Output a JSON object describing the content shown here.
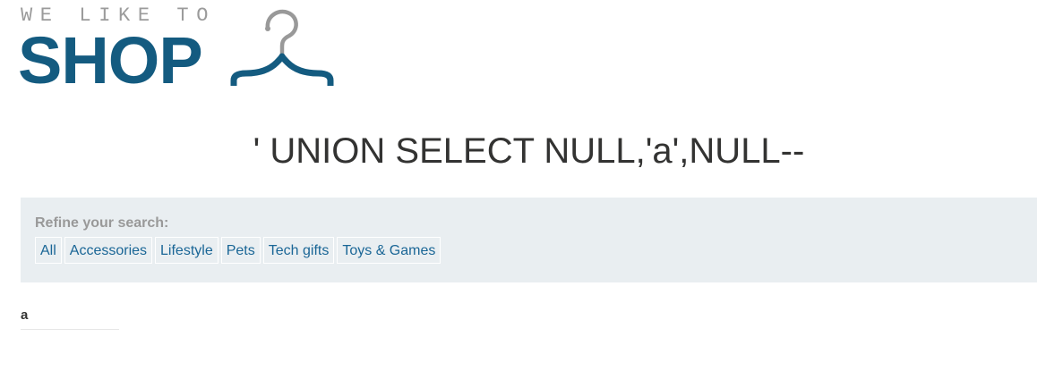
{
  "logo": {
    "tagline": "WE LIKE TO",
    "word": "SHOP",
    "icon": "hanger-icon",
    "colors": {
      "word": "#145b80",
      "tagline": "#9b9b9b",
      "hanger_hook": "#999999",
      "hanger_bar": "#145b80"
    }
  },
  "search": {
    "heading": "' UNION SELECT NULL,'a',NULL--"
  },
  "filters": {
    "label": "Refine your search:",
    "items": [
      {
        "label": "All"
      },
      {
        "label": "Accessories"
      },
      {
        "label": "Lifestyle"
      },
      {
        "label": "Pets"
      },
      {
        "label": "Tech gifts"
      },
      {
        "label": "Toys & Games"
      }
    ],
    "colors": {
      "panel_bg": "#e9eef1",
      "link": "#1a6696",
      "label": "#999999"
    }
  },
  "results": [
    {
      "text": "a"
    }
  ]
}
